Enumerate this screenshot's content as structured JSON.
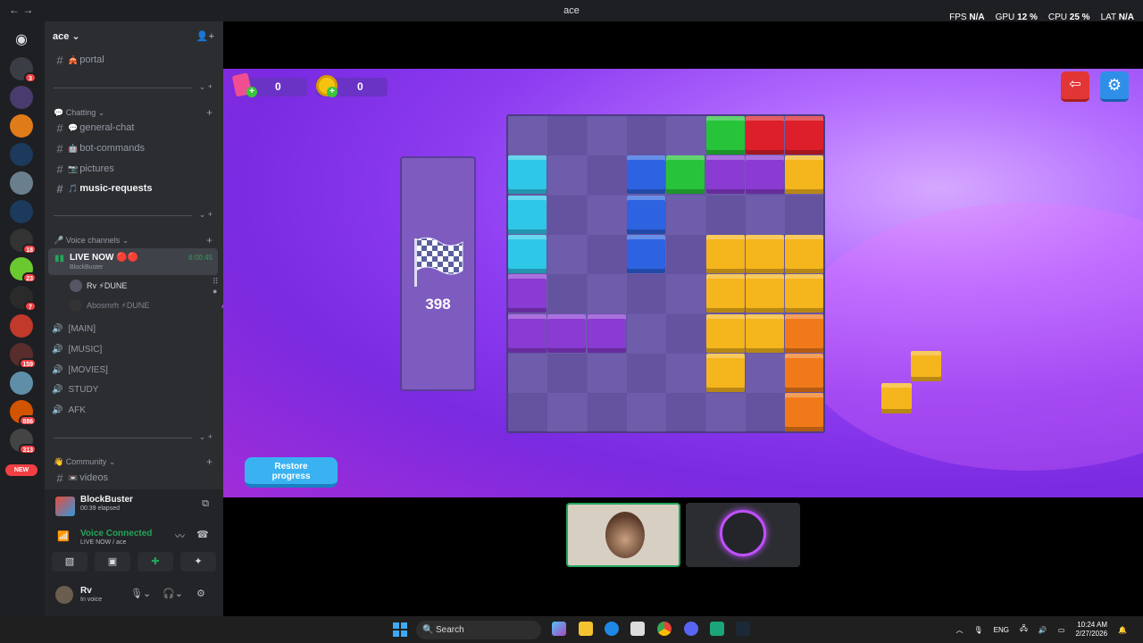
{
  "window": {
    "title": "ace",
    "perf": [
      {
        "label": "FPS",
        "value": "N/A"
      },
      {
        "label": "GPU",
        "value": "12 %"
      },
      {
        "label": "CPU",
        "value": "25 %"
      },
      {
        "label": "LAT",
        "value": "N/A"
      }
    ]
  },
  "rail": {
    "badges": [
      "3",
      "18",
      "23",
      "7",
      "159",
      "886",
      "313"
    ],
    "new_label": "NEW"
  },
  "server": {
    "name": "ace"
  },
  "channels": {
    "portal": "portal",
    "cat_chatting": "Chatting",
    "general": "general-chat",
    "bot": "bot-commands",
    "pictures": "pictures",
    "music": "music-requests",
    "cat_voice": "Voice channels",
    "live_name": "LIVE NOW",
    "live_sub": "BlockBuster",
    "live_timer": "6:00:45",
    "user1": "Rv ⚡DUNE",
    "user2": "Abosmrh ⚡DUNE",
    "main": "[MAIN]",
    "music_vc": "[MUSIC]",
    "movies": "[MOVIES]",
    "study": "STUDY",
    "afk": "AFK",
    "cat_community": "Community",
    "videos": "videos"
  },
  "activity": {
    "title": "BlockBuster",
    "elapsed": "00:39 elapsed"
  },
  "voice": {
    "status": "Voice Connected",
    "where": "LIVE NOW / ace"
  },
  "user": {
    "name": "Rv",
    "status": "In voice"
  },
  "game": {
    "gems": "0",
    "coins": "0",
    "score": "398",
    "restore_line1": "Restore",
    "restore_line2": "progress",
    "colors": {
      "cyan": "#2fc7e8",
      "blue": "#2d63e0",
      "green": "#27c43a",
      "red": "#dc1f2a",
      "purple": "#8a3bd1",
      "yellow": "#f5b51d",
      "orange": "#f07a1a"
    }
  },
  "taskbar": {
    "search": "Search",
    "lang": "ENG",
    "time": "10:24 AM",
    "date": "2/27/2026"
  }
}
